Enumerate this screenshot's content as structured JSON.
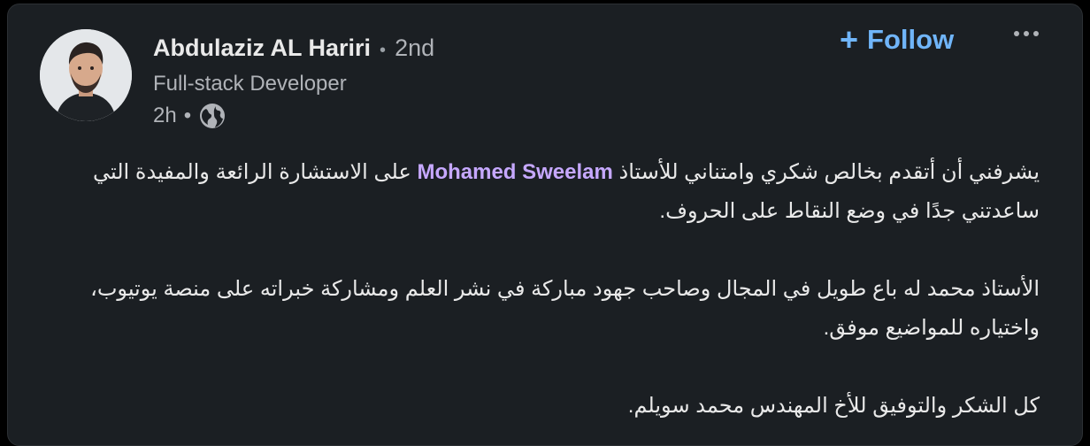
{
  "author": {
    "name": "Abdulaziz AL Hariri",
    "separator": "•",
    "degree": "2nd",
    "headline": "Full-stack Developer",
    "time": "2h",
    "meta_separator": "•",
    "visibility_icon": "globe-icon"
  },
  "actions": {
    "follow_icon": "plus-icon",
    "follow_plus": "+",
    "follow_label": "Follow",
    "more_icon": "more-horizontal-icon"
  },
  "post": {
    "p1_before": "يشرفني أن أتقدم بخالص شكري وامتناني للأستاذ ",
    "p1_mention": "Mohamed Sweelam",
    "p1_after": " على الاستشارة الرائعة والمفيدة التي ساعدتني جدًا في وضع النقاط على الحروف.",
    "p2": "الأستاذ محمد له باع طويل في المجال وصاحب جهود مباركة في نشر العلم ومشاركة خبراته على منصة يوتيوب، واختياره للمواضيع موفق.",
    "p3": "كل الشكر والتوفيق للأخ المهندس محمد سويلم."
  },
  "colors": {
    "background": "#1b1f23",
    "text": "#e9e9e9",
    "secondary_text": "#b0b3b8",
    "accent": "#70b5f9",
    "mention": "#c6a8ff"
  }
}
